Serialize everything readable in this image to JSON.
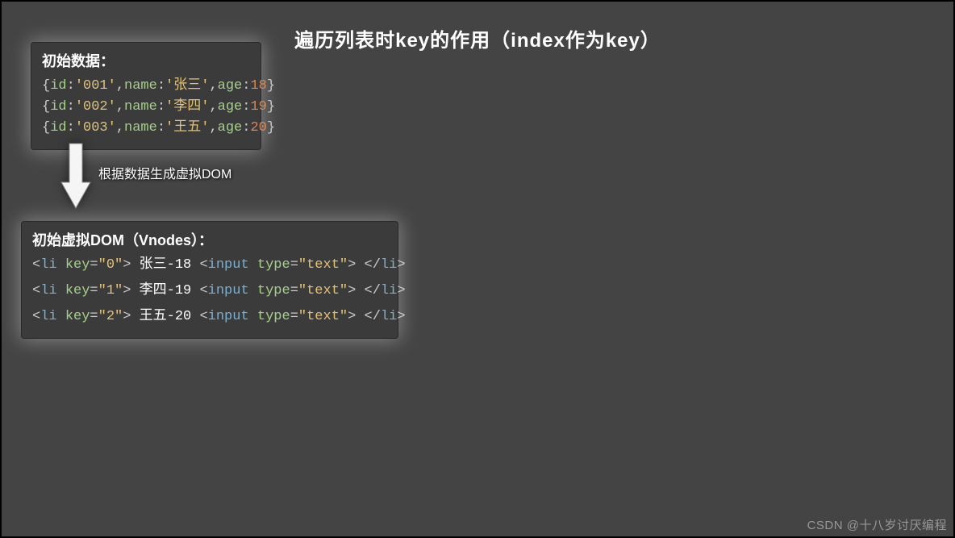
{
  "title": "遍历列表时key的作用（index作为key）",
  "arrow_label": "根据数据生成虚拟DOM",
  "watermark": "CSDN @十八岁讨厌编程",
  "initial": {
    "title": "初始数据：",
    "rows": [
      {
        "id": "'001'",
        "name": "'张三'",
        "age": "18"
      },
      {
        "id": "'002'",
        "name": "'李四'",
        "age": "19"
      },
      {
        "id": "'003'",
        "name": "'王五'",
        "age": "20"
      }
    ],
    "labels": {
      "id": "id",
      "name": "name",
      "age": "age"
    }
  },
  "vnodes": {
    "title": "初始虚拟DOM（Vnodes）：",
    "rows": [
      {
        "key": "\"0\"",
        "text": "张三-18",
        "type": "\"text\""
      },
      {
        "key": "\"1\"",
        "text": "李四-19",
        "type": "\"text\""
      },
      {
        "key": "\"2\"",
        "text": "王五-20",
        "type": "\"text\""
      }
    ],
    "tokens": {
      "li": "li",
      "key": "key",
      "input": "input",
      "type": "type",
      "lt": "<",
      "gt": ">",
      "sl": "/"
    }
  }
}
